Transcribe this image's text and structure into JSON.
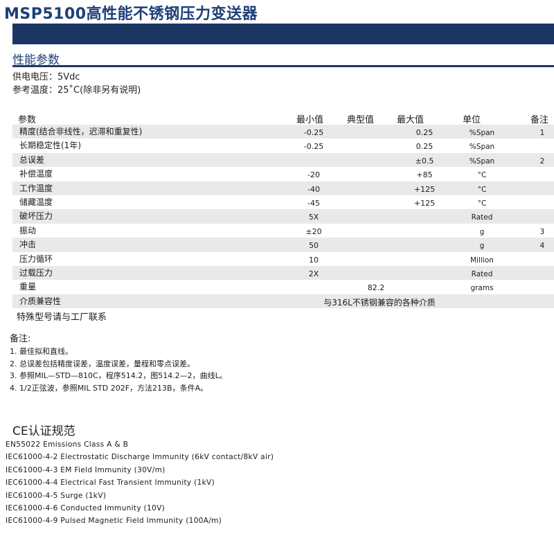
{
  "title": "MSP5100高性能不锈钢压力变送器",
  "section_title": "性能参数",
  "conditions": [
    "供电电压：5Vdc",
    "参考温度：25˚C(除非另有说明)"
  ],
  "table": {
    "headers": {
      "param": "参数",
      "min": "最小值",
      "typ": "典型值",
      "max": "最大值",
      "unit": "单位",
      "note": "备注"
    },
    "rows": [
      {
        "name": "精度(结合非线性，迟滞和重复性)",
        "min": "-0.25",
        "typ": "",
        "max": "0.25",
        "unit": "%Span",
        "note": "1"
      },
      {
        "name": "长期稳定性(1年)",
        "min": "-0.25",
        "typ": "",
        "max": "0.25",
        "unit": "%Span",
        "note": ""
      },
      {
        "name": "总误差",
        "min": "",
        "typ": "",
        "max": "±0.5",
        "unit": "%Span",
        "note": "2"
      },
      {
        "name": "补偿温度",
        "min": "-20",
        "typ": "",
        "max": "+85",
        "unit": "°C",
        "note": ""
      },
      {
        "name": "工作温度",
        "min": "-40",
        "typ": "",
        "max": "+125",
        "unit": "°C",
        "note": ""
      },
      {
        "name": "储藏温度",
        "min": "-45",
        "typ": "",
        "max": "+125",
        "unit": "°C",
        "note": ""
      },
      {
        "name": "破坏压力",
        "min": "5X",
        "typ": "",
        "max": "",
        "unit": "Rated",
        "note": ""
      },
      {
        "name": "振动",
        "min": "±20",
        "typ": "",
        "max": "",
        "unit": "g",
        "note": "3"
      },
      {
        "name": "冲击",
        "min": "50",
        "typ": "",
        "max": "",
        "unit": "g",
        "note": "4"
      },
      {
        "name": "压力循环",
        "min": "10",
        "typ": "",
        "max": "",
        "unit": "Million",
        "note": ""
      },
      {
        "name": "过载压力",
        "min": "2X",
        "typ": "",
        "max": "",
        "unit": "Rated",
        "note": ""
      },
      {
        "name": "重量",
        "min": "",
        "typ": "82.2",
        "max": "",
        "unit": "grams",
        "note": ""
      }
    ],
    "media_row": {
      "name": "介质兼容性",
      "value": "与316L不锈钢兼容的各种介质"
    },
    "special": "特殊型号请与工厂联系"
  },
  "notes": {
    "title": "备注:",
    "items": [
      "1. 最佳拟和直线。",
      "2. 总误差包括精度误差，温度误差，量程和零点误差。",
      "3. 参照MIL—STD—810C，程序514.2，图514.2—2，曲线L。",
      "4. 1/2正弦波，参照MIL STD 202F，方法213B，条件A。"
    ]
  },
  "ce": {
    "title": "CE认证规范",
    "items": [
      "EN55022 Emissions Class A & B",
      "IEC61000-4-2 Electrostatic Discharge Immunity (6kV contact/8kV air)",
      "IEC61000-4-3 EM Field Immunity (30V/m)",
      "IEC61000-4-4 Electrical Fast Transient Immunity (1kV)",
      "IEC61000-4-5 Surge (1kV)",
      "IEC61000-4-6 Conducted Immunity (10V)",
      "IEC61000-4-9 Pulsed Magnetic Field Immunity (100A/m)"
    ]
  }
}
